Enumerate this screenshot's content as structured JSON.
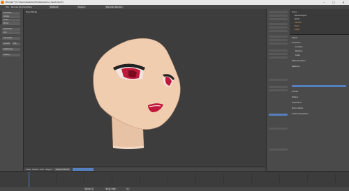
{
  "window": {
    "title": "Blender* [C:\\Users\\Desktop\\Models\\anime_head.blend]",
    "minimize": "–",
    "maximize": "☐",
    "close": "✕"
  },
  "menubar": {
    "items": [
      "File",
      "Render",
      "Window",
      "Help"
    ],
    "layout": "Default",
    "scene": "Scene",
    "engine": "Blender Render"
  },
  "toolshelf": {
    "buttons": [
      "Translate",
      "Rotate",
      "Scale",
      "Mirror",
      "Duplicate",
      "Join",
      "Set Origin",
      "Smooth",
      "Flat",
      "Keyframes",
      "History"
    ]
  },
  "viewport": {
    "view_label": "User Persp",
    "object_label": "(1) Head"
  },
  "outliner": {
    "items": [
      "Scene",
      "RenderLayers",
      "World",
      "Camera",
      "Head",
      "Lamp"
    ]
  },
  "properties": {
    "rows": [
      "Object",
      "Transform",
      "Location",
      "Rotation",
      "Scale",
      "Delta Transform",
      "Relations",
      "Groups",
      "Display",
      "Duplication",
      "Motion Paths",
      "Custom Properties"
    ]
  },
  "header3d": {
    "mode": "Object Mode",
    "view": "View",
    "select": "Select",
    "add": "Add",
    "object": "Object"
  },
  "timeline": {
    "start": "Start: 1",
    "end": "End: 250",
    "current": "1",
    "ticks": [
      "0",
      "20",
      "40",
      "60",
      "80",
      "100",
      "120",
      "140",
      "160",
      "180",
      "200",
      "220",
      "240"
    ]
  },
  "colors": {
    "skin": "#f1cdb0",
    "eye": "#c0183a",
    "accent": "#5680c2",
    "active": "#e87d0d"
  }
}
